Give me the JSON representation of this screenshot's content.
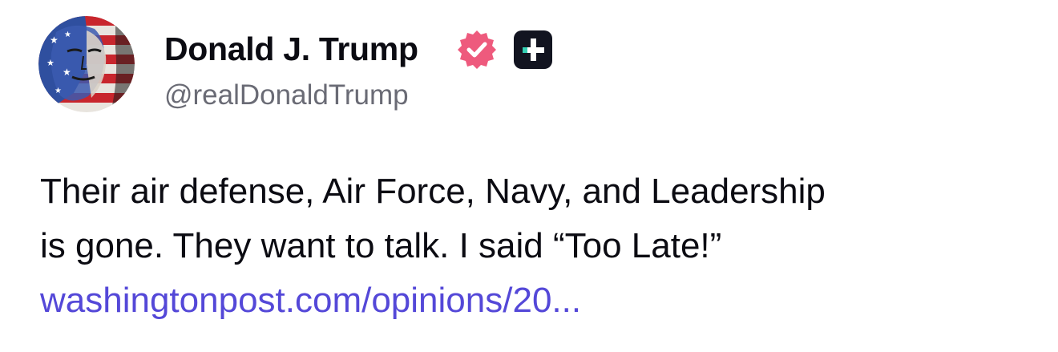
{
  "author": {
    "display_name": "Donald J. Trump",
    "handle": "@realDonaldTrump",
    "verified_icon": "verified-check-badge",
    "badge_icon": "plus-icon",
    "avatar_icon": "profile-avatar"
  },
  "post": {
    "text_lines": [
      "Their air defense, Air Force, Navy, and Leadership",
      "is gone. They want to talk. I said “Too Late!”"
    ],
    "link_text": "washingtonpost.com/opinions/20..."
  },
  "colors": {
    "verified_badge": "#ee5a7d",
    "link": "#5448d8",
    "handle": "#6a6b75",
    "plus_badge_bg": "#121420",
    "plus_badge_accent": "#35d0b4"
  }
}
